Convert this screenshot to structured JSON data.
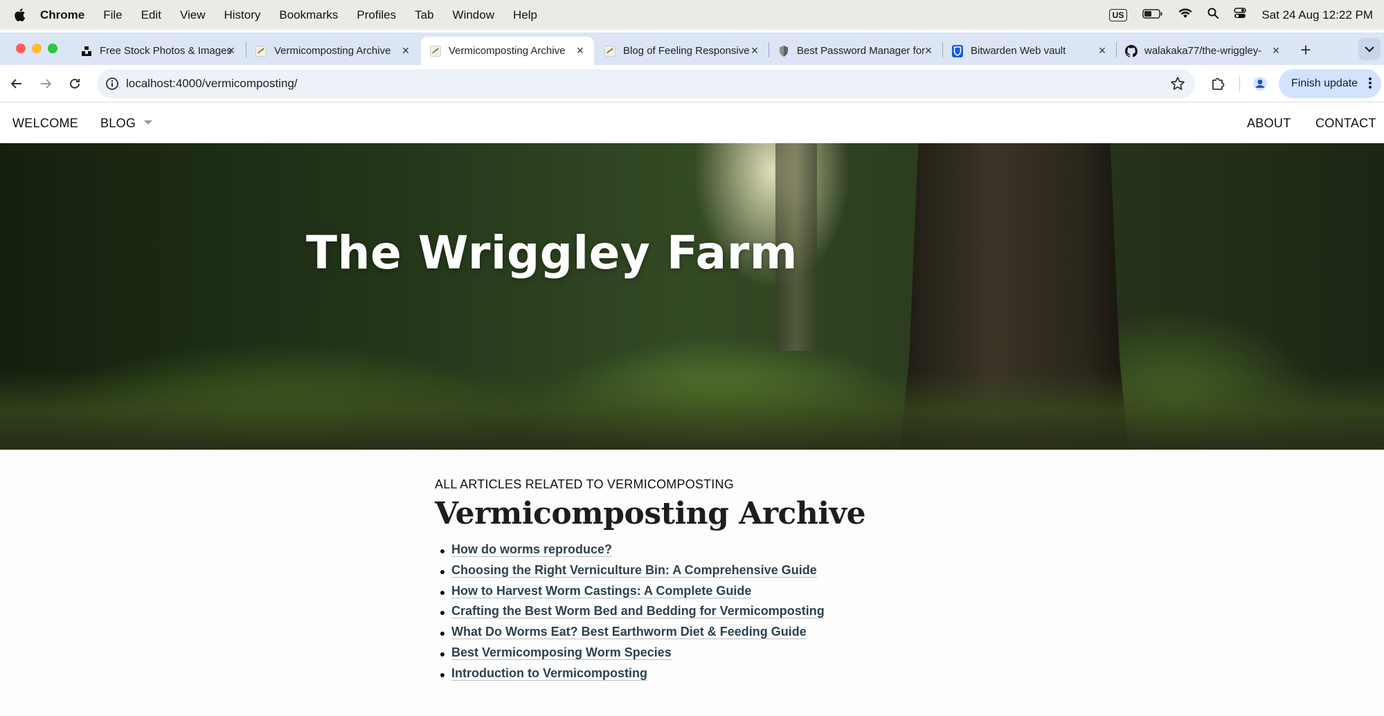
{
  "menubar": {
    "app": "Chrome",
    "items": [
      "File",
      "Edit",
      "View",
      "History",
      "Bookmarks",
      "Profiles",
      "Tab",
      "Window",
      "Help"
    ],
    "input_source": "US",
    "date_time": "Sat 24 Aug  12:22 PM"
  },
  "tabs": [
    {
      "title": "Free Stock Photos & Images",
      "icon": "unsplash-icon"
    },
    {
      "title": "Vermicomposting Archive",
      "icon": "worm-favicon"
    },
    {
      "title": "Vermicomposting Archive",
      "icon": "worm-favicon",
      "active": true
    },
    {
      "title": "Blog of Feeling Responsive",
      "icon": "worm-favicon"
    },
    {
      "title": "Best Password Manager for",
      "icon": "shield-icon"
    },
    {
      "title": "Bitwarden Web vault",
      "icon": "bitwarden-icon"
    },
    {
      "title": "walakaka77/the-wriggley-",
      "icon": "github-icon"
    }
  ],
  "toolbar": {
    "url_host": "localhost",
    "url_rest": ":4000/vermicomposting/",
    "finish_update": "Finish update"
  },
  "site": {
    "nav_left": [
      "WELCOME",
      "BLOG"
    ],
    "nav_right": [
      "ABOUT",
      "CONTACT"
    ],
    "hero_title": "The Wriggley Farm",
    "kicker": "ALL ARTICLES RELATED TO VERMICOMPOSTING",
    "heading": "Vermicomposting Archive",
    "articles": [
      "How do worms reproduce?",
      "Choosing the Right Verniculture Bin: A Comprehensive Guide",
      "How to Harvest Worm Castings: A Complete Guide",
      "Crafting the Best Worm Bed and Bedding for Vermicomposting",
      "What Do Worms Eat? Best Earthworm Diet & Feeding Guide",
      "Best Vermicomposing Worm Species",
      "Introduction to Vermicomposting"
    ]
  },
  "colors": {
    "tabstrip": "#dbe5f5",
    "link": "#2d4251",
    "finish_update_bg": "#d3e3fd"
  }
}
